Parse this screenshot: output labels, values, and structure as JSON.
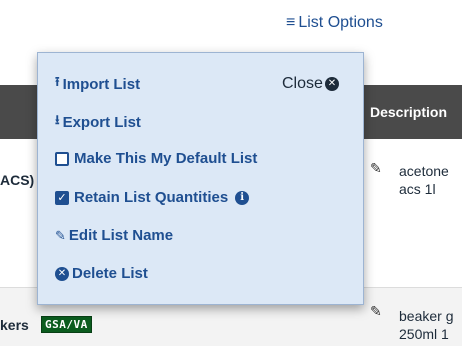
{
  "list_options": {
    "icon": "menu-icon",
    "label": "List Options"
  },
  "table": {
    "description_header": "Description",
    "rows": [
      {
        "code_fragment": "ACS)",
        "desc_line1": "acetone",
        "desc_line2": "acs 1l"
      },
      {
        "code_fragment": "kers",
        "badge": "GSA/VA",
        "desc_line1": "beaker g",
        "desc_line2": "250ml 1"
      }
    ]
  },
  "popup": {
    "close_label": "Close",
    "items": [
      {
        "icon": "upload-icon",
        "label": "Import List"
      },
      {
        "icon": "download-icon",
        "label": "Export List"
      },
      {
        "icon": "checkbox-unchecked",
        "label": "Make This My Default List",
        "checked": false
      },
      {
        "icon": "checkbox-checked",
        "label": "Retain List Quantities",
        "checked": true
      },
      {
        "icon": "pencil-icon",
        "label": "Edit List Name"
      },
      {
        "icon": "delete-circle-icon",
        "label": "Delete List"
      }
    ]
  },
  "colors": {
    "link_blue": "#1f4f91",
    "popup_bg": "#dce8f6",
    "header_bg": "#4a4a4a",
    "badge_green": "#0b5c1e"
  }
}
